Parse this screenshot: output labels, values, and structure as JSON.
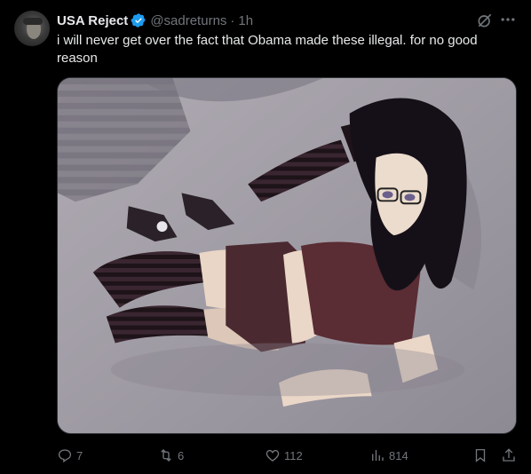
{
  "author": {
    "display_name": "USA Reject",
    "handle": "@sadreturns",
    "separator": "·",
    "time": "1h",
    "verified_color": "#1d9bf0"
  },
  "tweet": {
    "text": "i will never get over the fact that Obama made these illegal. for no good reason"
  },
  "icons": {
    "avatar": "avatar",
    "verified": "verified-badge-icon",
    "grok": "grok-icon",
    "more": "more-icon",
    "reply": "reply-icon",
    "retweet": "retweet-icon",
    "like": "like-icon",
    "views": "views-icon",
    "bookmark": "bookmark-icon",
    "share": "share-icon"
  },
  "metrics": {
    "replies": "7",
    "retweets": "6",
    "likes": "112",
    "views": "814"
  },
  "colors": {
    "background": "#000000",
    "text": "#e7e9ea",
    "muted": "#71767b",
    "accent": "#1d9bf0",
    "border": "#2f3336"
  }
}
